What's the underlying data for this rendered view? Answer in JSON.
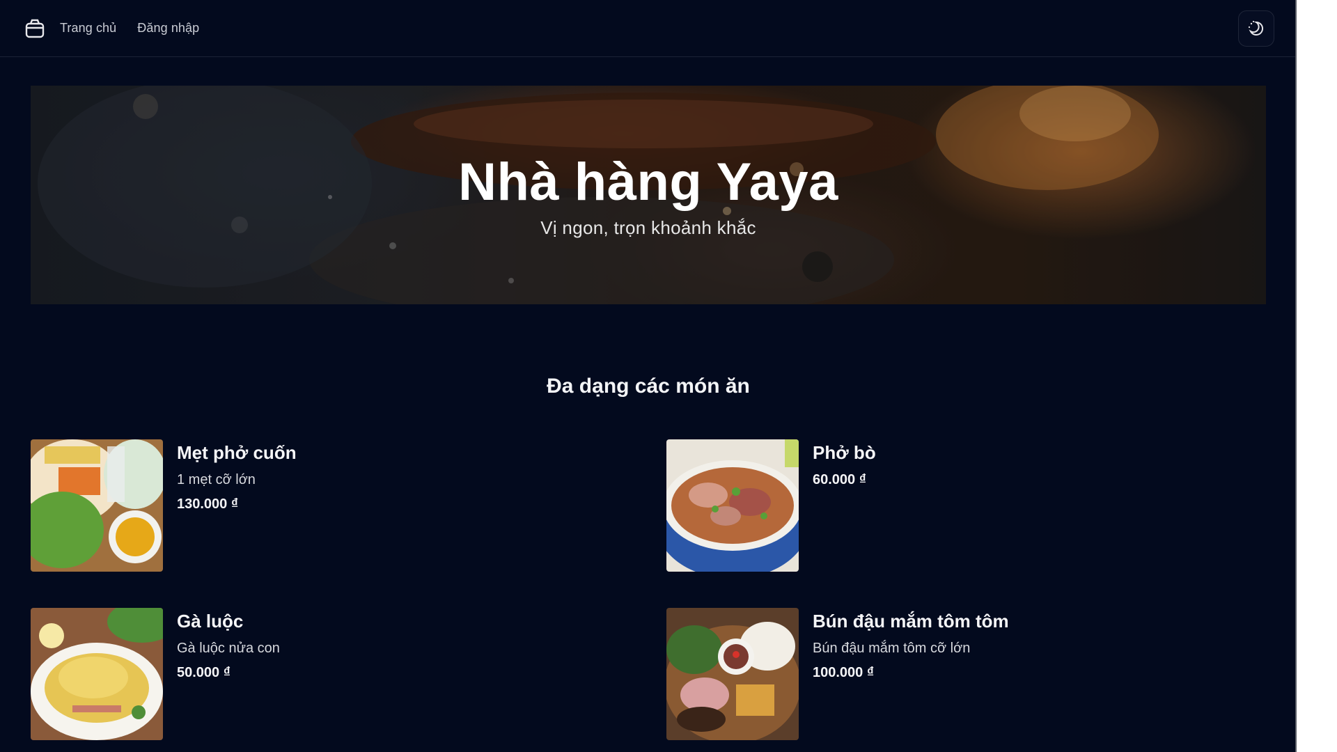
{
  "nav": {
    "home": "Trang chủ",
    "login": "Đăng nhập"
  },
  "hero": {
    "title": "Nhà hàng Yaya",
    "subtitle": "Vị ngon, trọn khoảnh khắc"
  },
  "section": {
    "title": "Đa dạng các món ăn"
  },
  "menu": [
    {
      "name": "Mẹt phở cuốn",
      "desc": "1 mẹt cỡ lớn",
      "price": "130.000 ₫"
    },
    {
      "name": "Phở bò",
      "desc": "",
      "price": "60.000 ₫"
    },
    {
      "name": "Gà luộc",
      "desc": "Gà luộc nửa con",
      "price": "50.000 ₫"
    },
    {
      "name": "Bún đậu mắm tôm tôm",
      "desc": "Bún đậu mắm tôm cỡ lớn",
      "price": "100.000 ₫"
    }
  ],
  "icons": {
    "logo": "box-icon",
    "theme": "moon-sun-toggle-icon"
  },
  "colors": {
    "background": "#030a1e",
    "text": "#f3f4f6"
  }
}
